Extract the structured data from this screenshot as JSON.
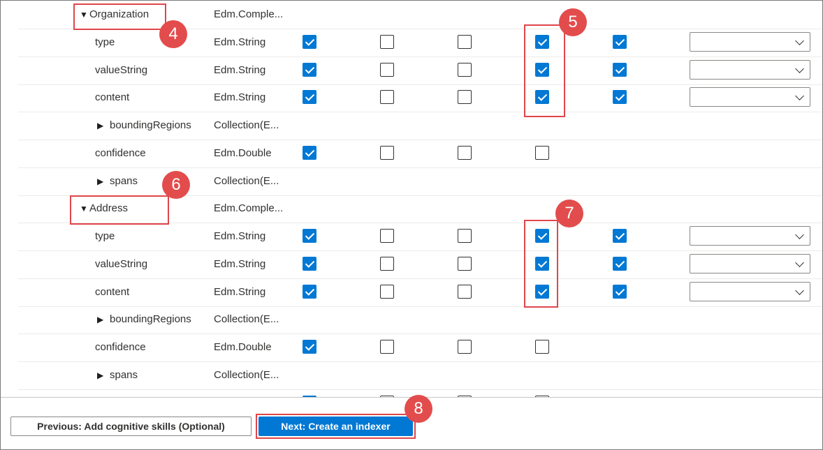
{
  "fields": [
    {
      "name": "Organization",
      "type": "Edm.Comple...",
      "caret": "▼",
      "checks": null,
      "dropdown": false
    },
    {
      "name": "type",
      "type": "Edm.String",
      "caret": "",
      "checks": [
        true,
        false,
        false,
        true,
        true
      ],
      "dropdown": true
    },
    {
      "name": "valueString",
      "type": "Edm.String",
      "caret": "",
      "checks": [
        true,
        false,
        false,
        true,
        true
      ],
      "dropdown": true
    },
    {
      "name": "content",
      "type": "Edm.String",
      "caret": "",
      "checks": [
        true,
        false,
        false,
        true,
        true
      ],
      "dropdown": true
    },
    {
      "name": "boundingRegions",
      "type": "Collection(E...",
      "caret": "▶",
      "checks": null,
      "dropdown": false
    },
    {
      "name": "confidence",
      "type": "Edm.Double",
      "caret": "",
      "checks": [
        true,
        false,
        false,
        false
      ],
      "dropdown": false
    },
    {
      "name": "spans",
      "type": "Collection(E...",
      "caret": "▶",
      "checks": null,
      "dropdown": false
    },
    {
      "name": "Address",
      "type": "Edm.Comple...",
      "caret": "▼",
      "checks": null,
      "dropdown": false
    },
    {
      "name": "type",
      "type": "Edm.String",
      "caret": "",
      "checks": [
        true,
        false,
        false,
        true,
        true
      ],
      "dropdown": true
    },
    {
      "name": "valueString",
      "type": "Edm.String",
      "caret": "",
      "checks": [
        true,
        false,
        false,
        true,
        true
      ],
      "dropdown": true
    },
    {
      "name": "content",
      "type": "Edm.String",
      "caret": "",
      "checks": [
        true,
        false,
        false,
        true,
        true
      ],
      "dropdown": true
    },
    {
      "name": "boundingRegions",
      "type": "Collection(E...",
      "caret": "▶",
      "checks": null,
      "dropdown": false
    },
    {
      "name": "confidence",
      "type": "Edm.Double",
      "caret": "",
      "checks": [
        true,
        false,
        false,
        false
      ],
      "dropdown": false
    },
    {
      "name": "spans",
      "type": "Collection(E...",
      "caret": "▶",
      "checks": null,
      "dropdown": false
    },
    {
      "name": "",
      "type": "",
      "caret": "",
      "checks": [
        true,
        false,
        false,
        false
      ],
      "dropdown": false
    }
  ],
  "annotations": {
    "badge4": "4",
    "badge5": "5",
    "badge6": "6",
    "badge7": "7",
    "badge8": "8",
    "color": "#e34c4c"
  },
  "footer": {
    "previous_label": "Previous: Add cognitive skills (Optional)",
    "next_label": "Next: Create an indexer"
  },
  "colors": {
    "accent": "#0078d4",
    "highlight": "#e0454a"
  }
}
